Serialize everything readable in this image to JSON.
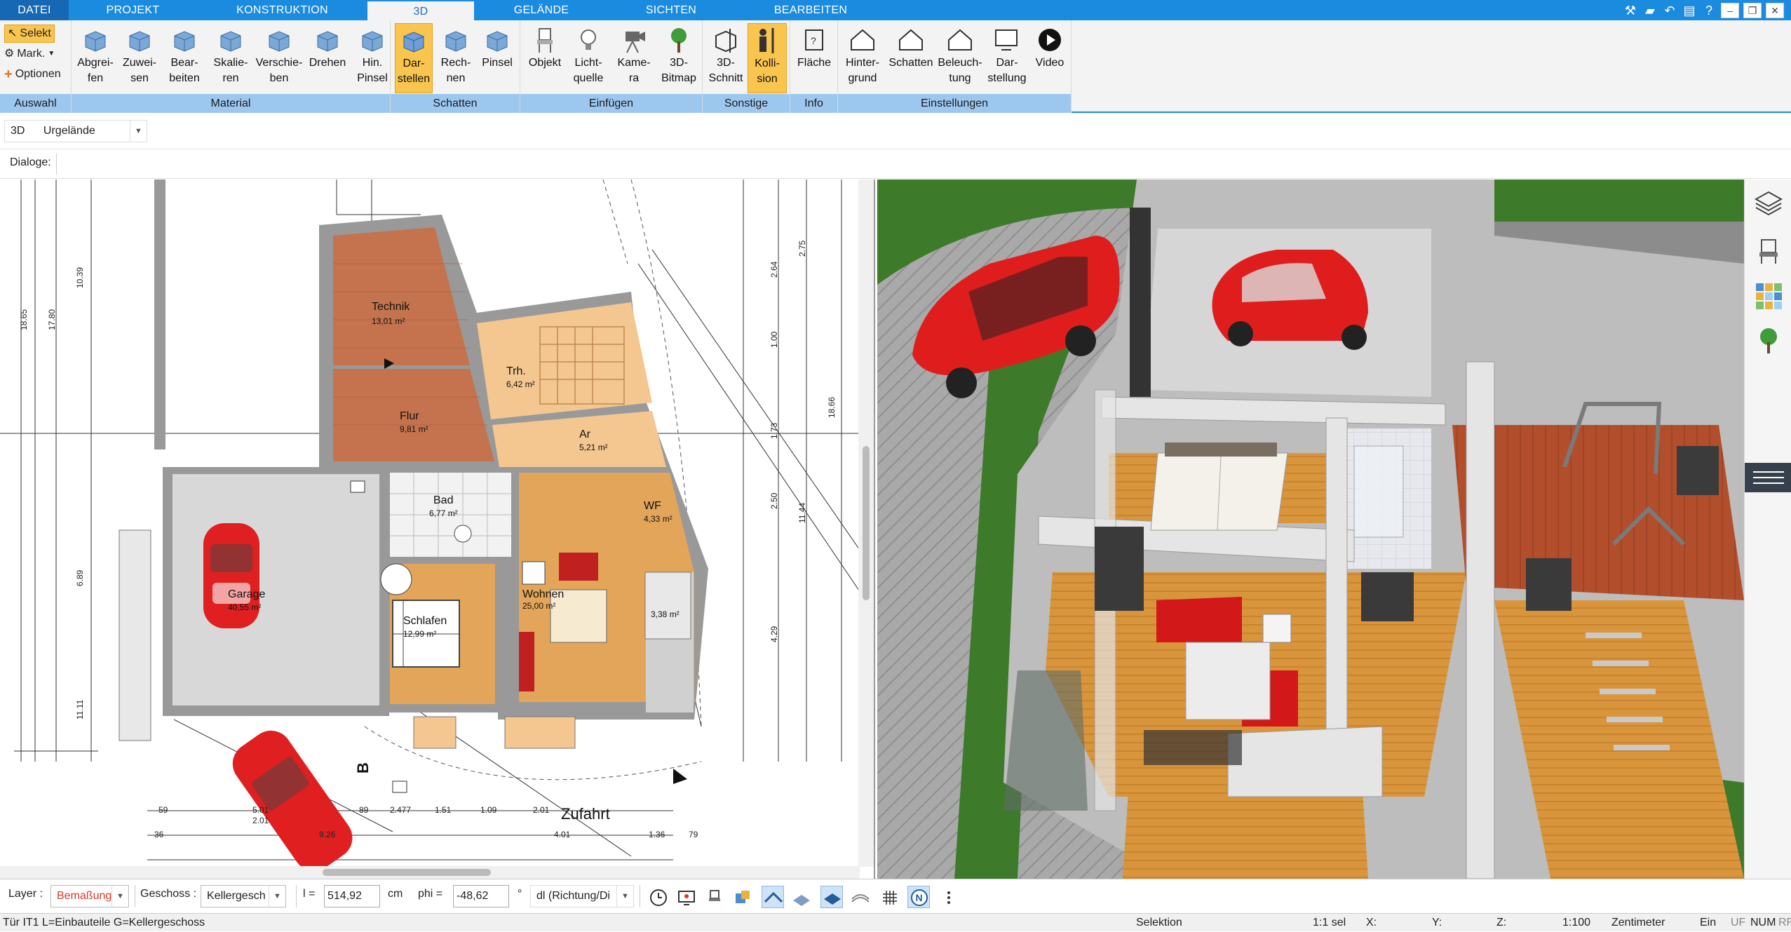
{
  "tabs": [
    {
      "label": "DATEI"
    },
    {
      "label": "PROJEKT"
    },
    {
      "label": "KONSTRUKTION"
    },
    {
      "label": "3D"
    },
    {
      "label": "GELÄNDE"
    },
    {
      "label": "SICHTEN"
    },
    {
      "label": "BEARBEITEN"
    }
  ],
  "ribbon": {
    "auswahl": {
      "label": "Auswahl",
      "selekt": "Selekt",
      "mark": "Mark.",
      "optionen": "Optionen"
    },
    "material": {
      "label": "Material",
      "buttons": [
        {
          "l1": "Abgrei-",
          "l2": "fen"
        },
        {
          "l1": "Zuwei-",
          "l2": "sen"
        },
        {
          "l1": "Bear-",
          "l2": "beiten"
        },
        {
          "l1": "Skalie-",
          "l2": "ren"
        },
        {
          "l1": "Verschie-",
          "l2": "ben"
        },
        {
          "l1": "Drehen",
          "l2": ""
        },
        {
          "l1": "Hin.",
          "l2": "Pinsel"
        }
      ]
    },
    "schatten": {
      "label": "Schatten",
      "buttons": [
        {
          "l1": "Dar-",
          "l2": "stellen"
        },
        {
          "l1": "Rech-",
          "l2": "nen"
        },
        {
          "l1": "Pinsel",
          "l2": ""
        }
      ]
    },
    "einfuegen": {
      "label": "Einfügen",
      "buttons": [
        {
          "l1": "Objekt",
          "l2": ""
        },
        {
          "l1": "Licht-",
          "l2": "quelle"
        },
        {
          "l1": "Kame-",
          "l2": "ra"
        },
        {
          "l1": "3D-",
          "l2": "Bitmap"
        }
      ]
    },
    "sonstige": {
      "label": "Sonstige",
      "buttons": [
        {
          "l1": "3D-",
          "l2": "Schnitt"
        },
        {
          "l1": "Kolli-",
          "l2": "sion"
        }
      ]
    },
    "info": {
      "label": "Info",
      "buttons": [
        {
          "l1": "Fläche",
          "l2": ""
        }
      ]
    },
    "einstellungen": {
      "label": "Einstellungen",
      "buttons": [
        {
          "l1": "Hinter-",
          "l2": "grund"
        },
        {
          "l1": "Schatten",
          "l2": ""
        },
        {
          "l1": "Beleuch-",
          "l2": "tung"
        },
        {
          "l1": "Dar-",
          "l2": "stellung"
        },
        {
          "l1": "Video",
          "l2": ""
        }
      ]
    }
  },
  "toolbar": {
    "mode": "3D",
    "terrain": "Urgelände",
    "dialoge": "Dialoge:"
  },
  "plan": {
    "rooms": [
      {
        "name": "Technik",
        "area": "13,01 m²"
      },
      {
        "name": "Trh.",
        "area": "6,42 m²"
      },
      {
        "name": "Flur",
        "area": "9,81 m²"
      },
      {
        "name": "Ar",
        "area": "5,21 m²"
      },
      {
        "name": "Bad",
        "area": "6,77 m²"
      },
      {
        "name": "WF",
        "area": "4,33 m²"
      },
      {
        "name": "Garage",
        "area": "40,55 m²"
      },
      {
        "name": "Schlafen",
        "area": "12,99 m²"
      },
      {
        "name": "Wohnen",
        "area": "25,00 m²"
      },
      {
        "name": "",
        "area": "3,38 m²"
      }
    ],
    "street": "Zufahrt",
    "section_marker": "B",
    "dims_left": [
      "10.39",
      "17.80",
      "18.65",
      "6.89",
      "11.11"
    ],
    "dims_right": [
      "2.64",
      "1.00",
      "2.75",
      "1.73",
      "2.50",
      "11.44",
      "4.29",
      "18.66"
    ],
    "dims_bottom": [
      "5.01",
      "2.01",
      "89",
      "2.477",
      "1.51",
      "1.09",
      "2.01",
      "59",
      "4.01",
      "1.36",
      "79",
      "36",
      "9.26"
    ]
  },
  "bottom": {
    "layer_label": "Layer :",
    "layer_value": "Bemaßung",
    "geschoss_label": "Geschoss :",
    "geschoss_value": "Kellergesch",
    "l_label": "l =",
    "l_value": "514,92",
    "unit": "cm",
    "phi_label": "phi =",
    "phi_value": "-48,62",
    "deg": "°",
    "dl_value": "dl (Richtung/Di"
  },
  "status": {
    "hint": "Tür IT1 L=Einbauteile G=Kellergeschoss",
    "mode": "Selektion",
    "sel": "1:1 sel",
    "x": "X:",
    "y": "Y:",
    "z": "Z:",
    "scale": "1:100",
    "unit": "Zentimeter",
    "ein": "Ein",
    "uf": "UF",
    "num": "NUM",
    "rf": "RF"
  },
  "colors": {
    "accent": "#1b8be0",
    "group_label": "#9cc8f0",
    "highlight": "#f9c54e",
    "car": "#e02020",
    "grass": "#3d7a2a"
  }
}
